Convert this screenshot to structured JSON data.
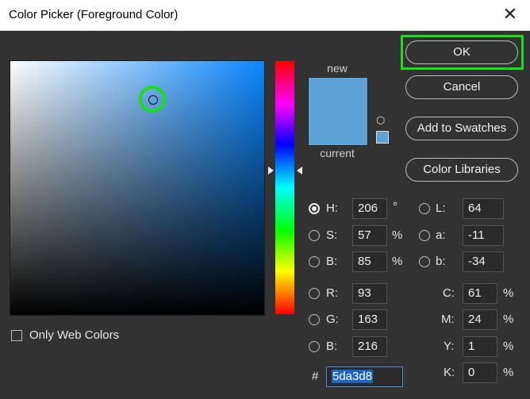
{
  "window": {
    "title": "Color Picker (Foreground Color)",
    "close_glyph": "✕"
  },
  "preview": {
    "new_label": "new",
    "current_label": "current",
    "new_color": "#5da3d8",
    "current_color": "#5da3d8",
    "cube_glyph": "⬡"
  },
  "buttons": {
    "ok": "OK",
    "cancel": "Cancel",
    "add_to_swatches": "Add to Swatches",
    "color_libraries": "Color Libraries"
  },
  "fields": {
    "H": {
      "label": "H:",
      "value": "206",
      "unit": "°"
    },
    "S": {
      "label": "S:",
      "value": "57",
      "unit": "%"
    },
    "Bv": {
      "label": "B:",
      "value": "85",
      "unit": "%"
    },
    "R": {
      "label": "R:",
      "value": "93"
    },
    "G": {
      "label": "G:",
      "value": "163"
    },
    "Bb": {
      "label": "B:",
      "value": "216"
    },
    "L": {
      "label": "L:",
      "value": "64"
    },
    "a": {
      "label": "a:",
      "value": "-11"
    },
    "b": {
      "label": "b:",
      "value": "-34"
    },
    "C": {
      "label": "C:",
      "value": "61",
      "unit": "%"
    },
    "M": {
      "label": "M:",
      "value": "24",
      "unit": "%"
    },
    "Y": {
      "label": "Y:",
      "value": "1",
      "unit": "%"
    },
    "K": {
      "label": "K:",
      "value": "0",
      "unit": "%"
    }
  },
  "hex": {
    "label": "#",
    "value": "5da3d8"
  },
  "only_web_colors": {
    "label": "Only Web Colors",
    "checked": false
  },
  "colors": {
    "accent_highlight": "#18e018",
    "selected_color": "#5da3d8"
  }
}
